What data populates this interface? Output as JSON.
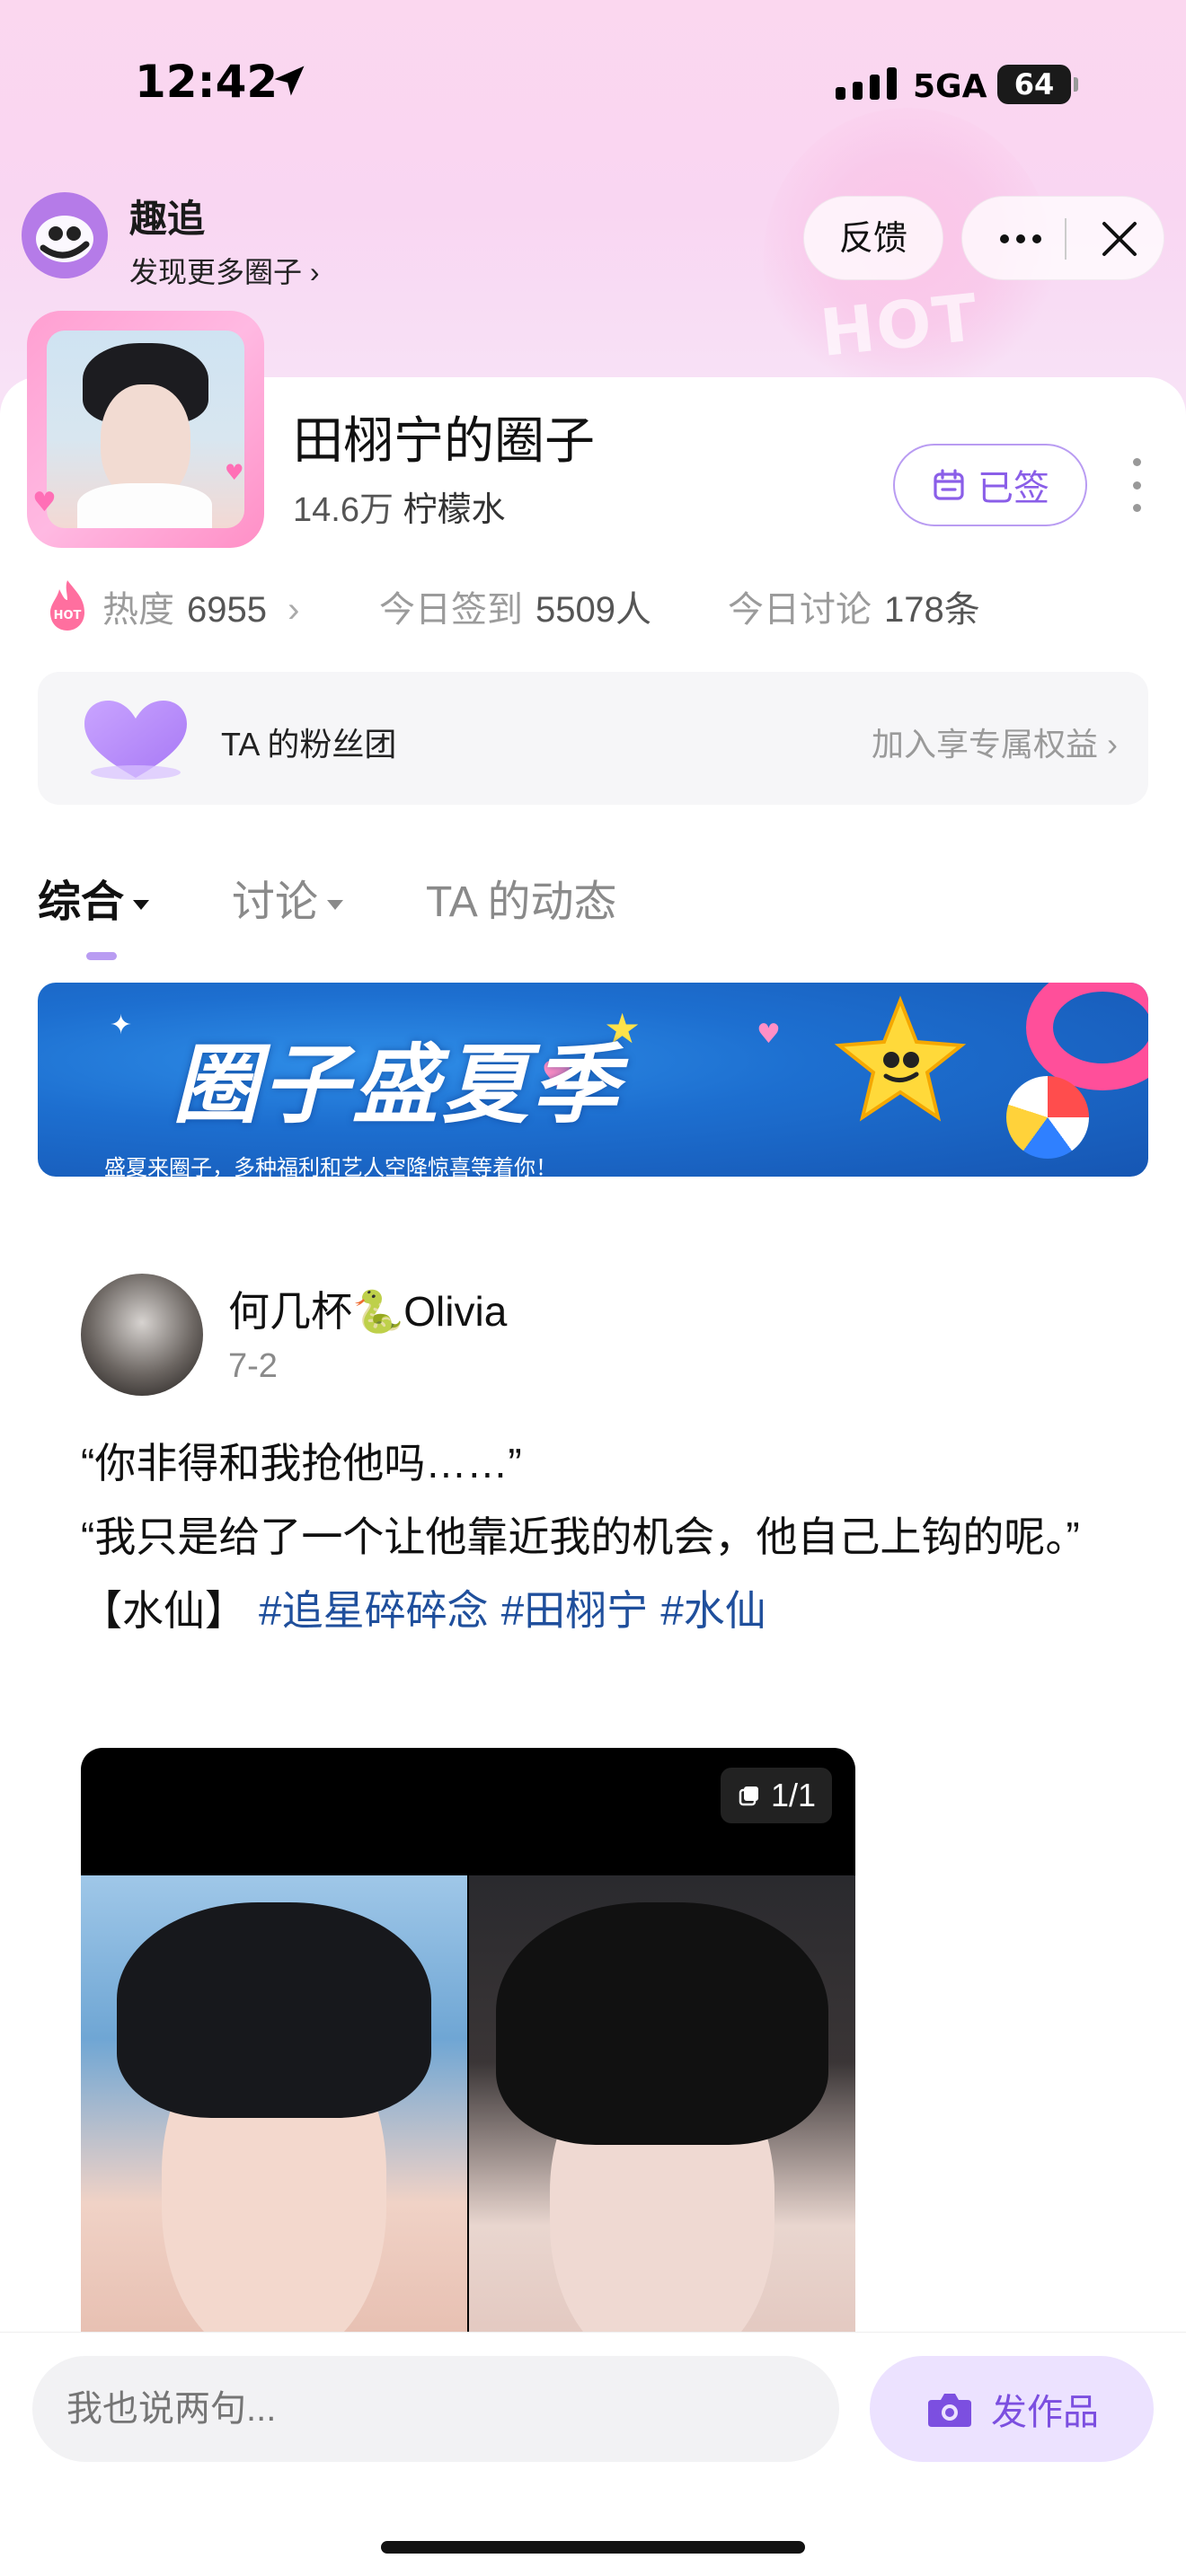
{
  "status_bar": {
    "time": "12:42",
    "network": "5GA",
    "battery": "64"
  },
  "app_header": {
    "app_name": "趣追",
    "subtitle": "发现更多圈子 ›",
    "feedback_label": "反馈"
  },
  "circle": {
    "title": "田栩宁的圈子",
    "member_count": "14.6万",
    "member_unit": "柠檬水",
    "signed_label": "已签"
  },
  "stats": {
    "heat_label": "热度",
    "heat_value": "6955",
    "checkin_label": "今日签到",
    "checkin_value": "5509人",
    "discuss_label": "今日讨论",
    "discuss_value": "178条"
  },
  "fanclub": {
    "label": "TA 的粉丝团",
    "cta": "加入享专属权益 ›"
  },
  "tabs": [
    {
      "label": "综合",
      "active": true,
      "dropdown": true
    },
    {
      "label": "讨论",
      "active": false,
      "dropdown": true
    },
    {
      "label": "TA 的动态",
      "active": false,
      "dropdown": false
    }
  ],
  "banner": {
    "title": "圈子盛夏季",
    "subtitle": "盛夏来圈子，多种福利和艺人空降惊喜等着你！"
  },
  "post": {
    "author": "何几杯🐍Olivia",
    "date": "7-2",
    "line1": "“你非得和我抢他吗……”",
    "line2": "“我只是给了一个让他靠近我的机会，他自己上钩的呢。”",
    "prefix": "【水仙】",
    "tags": [
      "#追星碎碎念",
      "#田栩宁",
      "#水仙"
    ],
    "media_counter": "1/1"
  },
  "bottom_bar": {
    "comment_placeholder": "我也说两句...",
    "publish_label": "发作品"
  },
  "colors": {
    "accent": "#8a5ee8",
    "tag_link": "#1f4f9c",
    "top_gradient": "#fbd7ef"
  }
}
